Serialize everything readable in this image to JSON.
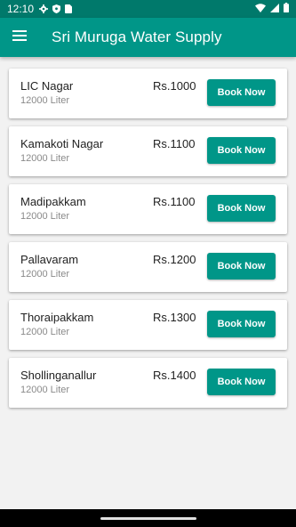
{
  "status_bar": {
    "time": "12:10",
    "left_icons": [
      "gear-icon",
      "shield-icon",
      "sim-card-icon"
    ],
    "right_icons": [
      "wifi-icon",
      "signal-icon",
      "battery-icon"
    ]
  },
  "app_bar": {
    "title": "Sri Muruga Water Supply",
    "menu_icon": "menu-icon",
    "background": "#009688",
    "status_background": "#00796b"
  },
  "items": [
    {
      "name": "LIC Nagar",
      "quantity": "12000 Liter",
      "price": "Rs.1000",
      "button": "Book Now"
    },
    {
      "name": "Kamakoti Nagar",
      "quantity": "12000 Liter",
      "price": "Rs.1100",
      "button": "Book Now"
    },
    {
      "name": "Madipakkam",
      "quantity": "12000 Liter",
      "price": "Rs.1100",
      "button": "Book Now"
    },
    {
      "name": "Pallavaram",
      "quantity": "12000 Liter",
      "price": "Rs.1200",
      "button": "Book Now"
    },
    {
      "name": "Thoraipakkam",
      "quantity": "12000 Liter",
      "price": "Rs.1300",
      "button": "Book Now"
    },
    {
      "name": "Shollinganallur",
      "quantity": "12000 Liter",
      "price": "Rs.1400",
      "button": "Book Now"
    }
  ],
  "theme": {
    "accent": "#009688",
    "card": "#ffffff",
    "page": "#f2f2f2"
  }
}
